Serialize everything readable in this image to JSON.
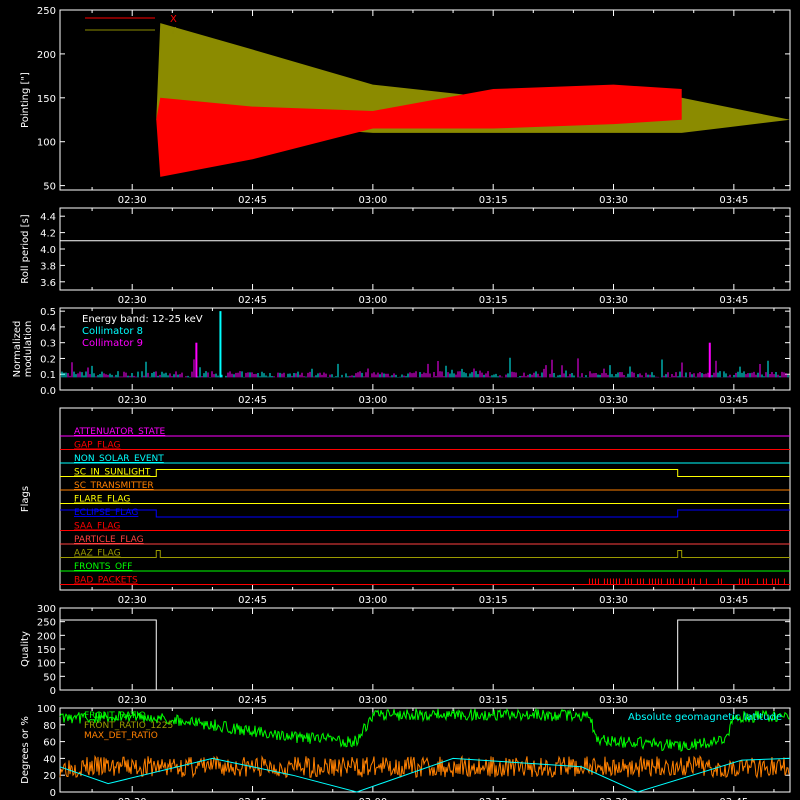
{
  "time_ticks": [
    "02:30",
    "02:45",
    "03:00",
    "03:15",
    "03:30",
    "03:45"
  ],
  "chart_data": [
    {
      "type": "line",
      "ylabel": "Pointing [\"]",
      "ylim": [
        45,
        250
      ],
      "yticks": [
        50,
        100,
        150,
        200,
        250
      ],
      "legend_placement": "top-left",
      "series": [
        {
          "name": "X",
          "color": "#ff0000",
          "x": [
            "02:21:00",
            "02:33:00",
            "02:33:30",
            "02:45:00",
            "03:00:00",
            "03:15:00",
            "03:30:00",
            "03:38:30",
            "03:38:30",
            "03:38:30"
          ],
          "upper": [
            125,
            125,
            150,
            140,
            135,
            160,
            165,
            160,
            215,
            125
          ],
          "lower": [
            125,
            125,
            60,
            80,
            115,
            115,
            120,
            125,
            70,
            125
          ]
        },
        {
          "name": "Y",
          "color": "#8b8b00",
          "x": [
            "02:21:00",
            "02:33:00",
            "02:33:30",
            "02:45:00",
            "03:00:00",
            "03:15:00",
            "03:30:00",
            "03:38:30",
            "03:52:00"
          ],
          "upper": [
            125,
            125,
            235,
            205,
            165,
            150,
            150,
            150,
            125
          ],
          "lower": [
            125,
            125,
            130,
            120,
            110,
            110,
            110,
            110,
            125
          ]
        }
      ]
    },
    {
      "type": "line",
      "ylabel": "Roll period [s]",
      "ylim": [
        3.5,
        4.5
      ],
      "yticks": [
        "3.6",
        "3.8",
        "4.0",
        "4.2",
        "4.4"
      ],
      "series": [
        {
          "color": "#ffffff",
          "x": [
            "02:21:00",
            "03:52:00"
          ],
          "values": [
            4.1,
            4.1
          ]
        }
      ]
    },
    {
      "type": "bar",
      "ylabel": [
        "Normalized",
        "modulation"
      ],
      "ylim": [
        0,
        0.52
      ],
      "yticks": [
        "0.0",
        "0.1",
        "0.2",
        "0.3",
        "0.4",
        "0.5"
      ],
      "legend": {
        "title": "Energy band: 12-25 keV",
        "items": [
          {
            "name": "Collimator 8",
            "color": "#00ffff"
          },
          {
            "name": "Collimator 9",
            "color": "#ff00ff"
          }
        ]
      },
      "baseline": 0.1,
      "notable_spikes": [
        {
          "x": "02:41:00",
          "value": 0.5,
          "series": "Collimator 8"
        },
        {
          "x": "02:38:00",
          "value": 0.3,
          "series": "Collimator 9"
        },
        {
          "x": "03:42:00",
          "value": 0.3,
          "series": "Collimator 9"
        }
      ]
    },
    {
      "type": "table",
      "ylabel": "Flags",
      "flags": [
        {
          "name": "ATTENUATOR_STATE",
          "color": "#ff00ff",
          "state": "off"
        },
        {
          "name": "GAP_FLAG",
          "color": "#ff0000",
          "state": "off"
        },
        {
          "name": "NON_SOLAR_EVENT",
          "color": "#00ffff",
          "state": "off"
        },
        {
          "name": "SC_IN_SUNLIGHT",
          "color": "#ffff00",
          "state": "on",
          "on_from": "02:33:00",
          "on_to": "03:38:00"
        },
        {
          "name": "SC_TRANSMITTER",
          "color": "#ff8000",
          "state": "off"
        },
        {
          "name": "FLARE_FLAG",
          "color": "#ffff00",
          "state": "off"
        },
        {
          "name": "ECLIPSE_FLAG",
          "color": "#0000ff",
          "state": "on",
          "on_before": "02:33:00",
          "on_after": "03:38:00"
        },
        {
          "name": "SAA_FLAG",
          "color": "#ff0000",
          "state": "off"
        },
        {
          "name": "PARTICLE_FLAG",
          "color": "#ff4040",
          "state": "off"
        },
        {
          "name": "AAZ_FLAG",
          "color": "#9b9b00",
          "state": "pulse",
          "pulses": [
            "02:33:00",
            "03:38:00"
          ]
        },
        {
          "name": "FRONTS_OFF",
          "color": "#00ff00",
          "state": "off"
        },
        {
          "name": "BAD_PACKETS",
          "color": "#ff0000",
          "state": "intermittent",
          "from": "03:27:00"
        }
      ]
    },
    {
      "type": "line",
      "ylabel": "Quality",
      "ylim": [
        0,
        300
      ],
      "yticks": [
        0,
        50,
        100,
        150,
        200,
        250,
        300
      ],
      "series": [
        {
          "color": "#ffffff",
          "x": [
            "02:21:00",
            "02:33:00",
            "02:33:00",
            "03:38:00",
            "03:38:00",
            "03:52:00"
          ],
          "values": [
            256,
            256,
            0,
            0,
            256,
            256
          ]
        }
      ]
    },
    {
      "type": "line",
      "ylabel": "Degrees or %",
      "ylim": [
        0,
        100
      ],
      "yticks": [
        0,
        20,
        40,
        60,
        80,
        100
      ],
      "legend_left": [
        {
          "name": "FRONT_RATIO",
          "color": "#00ff00"
        },
        {
          "name": "FRONT_RATIO_1225",
          "color": "#9b9b00"
        },
        {
          "name": "MAX_DET_RATIO",
          "color": "#ff8000"
        }
      ],
      "legend_right": {
        "name": "Absolute geomagnetic latitude",
        "color": "#00ffff"
      },
      "series": [
        {
          "name": "FRONT_RATIO",
          "color": "#00ff00",
          "x": [
            "02:21:00",
            "02:32:00",
            "02:40:00",
            "02:50:00",
            "02:58:00",
            "03:00:00",
            "03:10:00",
            "03:20:00",
            "03:27:00",
            "03:28:00",
            "03:38:00",
            "03:44:00",
            "03:45:00",
            "03:52:00"
          ],
          "values": [
            88,
            90,
            80,
            65,
            60,
            92,
            92,
            92,
            90,
            62,
            55,
            60,
            90,
            90
          ]
        },
        {
          "name": "MAX_DET_RATIO",
          "color": "#ff8000",
          "mean": 30
        },
        {
          "name": "Absolute geomagnetic latitude",
          "color": "#00ffff",
          "x": [
            "02:21:00",
            "02:27:00",
            "02:40:00",
            "02:50:00",
            "02:58:00",
            "03:10:00",
            "03:26:00",
            "03:33:00",
            "03:46:00",
            "03:52:00"
          ],
          "values": [
            30,
            10,
            40,
            20,
            0,
            40,
            30,
            0,
            38,
            40
          ]
        }
      ]
    }
  ]
}
